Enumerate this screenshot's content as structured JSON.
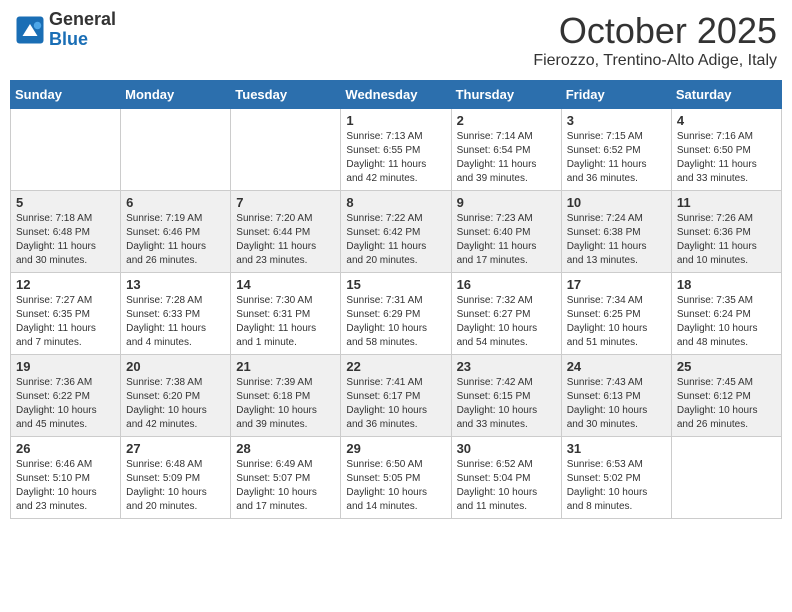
{
  "header": {
    "logo_general": "General",
    "logo_blue": "Blue",
    "month_title": "October 2025",
    "location": "Fierozzo, Trentino-Alto Adige, Italy"
  },
  "days_of_week": [
    "Sunday",
    "Monday",
    "Tuesday",
    "Wednesday",
    "Thursday",
    "Friday",
    "Saturday"
  ],
  "weeks": [
    [
      {
        "day": "",
        "info": ""
      },
      {
        "day": "",
        "info": ""
      },
      {
        "day": "",
        "info": ""
      },
      {
        "day": "1",
        "info": "Sunrise: 7:13 AM\nSunset: 6:55 PM\nDaylight: 11 hours and 42 minutes."
      },
      {
        "day": "2",
        "info": "Sunrise: 7:14 AM\nSunset: 6:54 PM\nDaylight: 11 hours and 39 minutes."
      },
      {
        "day": "3",
        "info": "Sunrise: 7:15 AM\nSunset: 6:52 PM\nDaylight: 11 hours and 36 minutes."
      },
      {
        "day": "4",
        "info": "Sunrise: 7:16 AM\nSunset: 6:50 PM\nDaylight: 11 hours and 33 minutes."
      }
    ],
    [
      {
        "day": "5",
        "info": "Sunrise: 7:18 AM\nSunset: 6:48 PM\nDaylight: 11 hours and 30 minutes."
      },
      {
        "day": "6",
        "info": "Sunrise: 7:19 AM\nSunset: 6:46 PM\nDaylight: 11 hours and 26 minutes."
      },
      {
        "day": "7",
        "info": "Sunrise: 7:20 AM\nSunset: 6:44 PM\nDaylight: 11 hours and 23 minutes."
      },
      {
        "day": "8",
        "info": "Sunrise: 7:22 AM\nSunset: 6:42 PM\nDaylight: 11 hours and 20 minutes."
      },
      {
        "day": "9",
        "info": "Sunrise: 7:23 AM\nSunset: 6:40 PM\nDaylight: 11 hours and 17 minutes."
      },
      {
        "day": "10",
        "info": "Sunrise: 7:24 AM\nSunset: 6:38 PM\nDaylight: 11 hours and 13 minutes."
      },
      {
        "day": "11",
        "info": "Sunrise: 7:26 AM\nSunset: 6:36 PM\nDaylight: 11 hours and 10 minutes."
      }
    ],
    [
      {
        "day": "12",
        "info": "Sunrise: 7:27 AM\nSunset: 6:35 PM\nDaylight: 11 hours and 7 minutes."
      },
      {
        "day": "13",
        "info": "Sunrise: 7:28 AM\nSunset: 6:33 PM\nDaylight: 11 hours and 4 minutes."
      },
      {
        "day": "14",
        "info": "Sunrise: 7:30 AM\nSunset: 6:31 PM\nDaylight: 11 hours and 1 minute."
      },
      {
        "day": "15",
        "info": "Sunrise: 7:31 AM\nSunset: 6:29 PM\nDaylight: 10 hours and 58 minutes."
      },
      {
        "day": "16",
        "info": "Sunrise: 7:32 AM\nSunset: 6:27 PM\nDaylight: 10 hours and 54 minutes."
      },
      {
        "day": "17",
        "info": "Sunrise: 7:34 AM\nSunset: 6:25 PM\nDaylight: 10 hours and 51 minutes."
      },
      {
        "day": "18",
        "info": "Sunrise: 7:35 AM\nSunset: 6:24 PM\nDaylight: 10 hours and 48 minutes."
      }
    ],
    [
      {
        "day": "19",
        "info": "Sunrise: 7:36 AM\nSunset: 6:22 PM\nDaylight: 10 hours and 45 minutes."
      },
      {
        "day": "20",
        "info": "Sunrise: 7:38 AM\nSunset: 6:20 PM\nDaylight: 10 hours and 42 minutes."
      },
      {
        "day": "21",
        "info": "Sunrise: 7:39 AM\nSunset: 6:18 PM\nDaylight: 10 hours and 39 minutes."
      },
      {
        "day": "22",
        "info": "Sunrise: 7:41 AM\nSunset: 6:17 PM\nDaylight: 10 hours and 36 minutes."
      },
      {
        "day": "23",
        "info": "Sunrise: 7:42 AM\nSunset: 6:15 PM\nDaylight: 10 hours and 33 minutes."
      },
      {
        "day": "24",
        "info": "Sunrise: 7:43 AM\nSunset: 6:13 PM\nDaylight: 10 hours and 30 minutes."
      },
      {
        "day": "25",
        "info": "Sunrise: 7:45 AM\nSunset: 6:12 PM\nDaylight: 10 hours and 26 minutes."
      }
    ],
    [
      {
        "day": "26",
        "info": "Sunrise: 6:46 AM\nSunset: 5:10 PM\nDaylight: 10 hours and 23 minutes."
      },
      {
        "day": "27",
        "info": "Sunrise: 6:48 AM\nSunset: 5:09 PM\nDaylight: 10 hours and 20 minutes."
      },
      {
        "day": "28",
        "info": "Sunrise: 6:49 AM\nSunset: 5:07 PM\nDaylight: 10 hours and 17 minutes."
      },
      {
        "day": "29",
        "info": "Sunrise: 6:50 AM\nSunset: 5:05 PM\nDaylight: 10 hours and 14 minutes."
      },
      {
        "day": "30",
        "info": "Sunrise: 6:52 AM\nSunset: 5:04 PM\nDaylight: 10 hours and 11 minutes."
      },
      {
        "day": "31",
        "info": "Sunrise: 6:53 AM\nSunset: 5:02 PM\nDaylight: 10 hours and 8 minutes."
      },
      {
        "day": "",
        "info": ""
      }
    ]
  ]
}
